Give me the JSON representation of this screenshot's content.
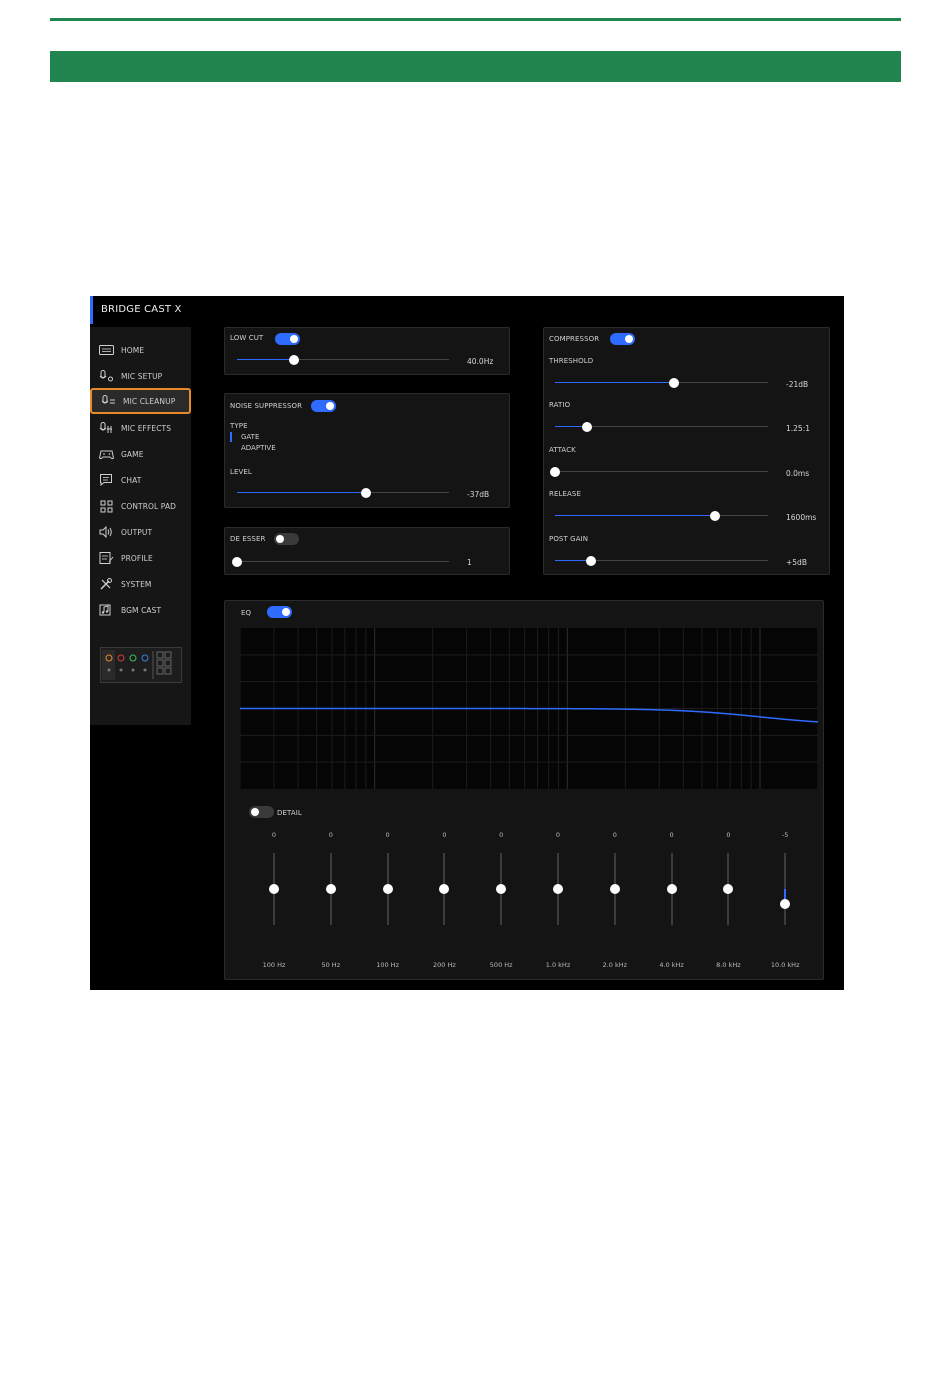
{
  "colors": {
    "doc_green": "#21854f",
    "accent_blue": "#2f6bff",
    "selection_orange": "#e8892a",
    "app_bg": "#000000",
    "panel_bg": "#141414"
  },
  "app": {
    "title": "BRIDGE CAST X"
  },
  "sidebar": {
    "items": [
      {
        "label": "HOME",
        "icon": "home-icon"
      },
      {
        "label": "MIC SETUP",
        "icon": "mic-setup-icon"
      },
      {
        "label": "MIC CLEANUP",
        "icon": "mic-cleanup-icon",
        "selected": true
      },
      {
        "label": "MIC EFFECTS",
        "icon": "mic-effects-icon"
      },
      {
        "label": "GAME",
        "icon": "gamepad-icon"
      },
      {
        "label": "CHAT",
        "icon": "chat-icon"
      },
      {
        "label": "CONTROL PAD",
        "icon": "control-pad-icon"
      },
      {
        "label": "OUTPUT",
        "icon": "speaker-icon"
      },
      {
        "label": "PROFILE",
        "icon": "profile-icon"
      },
      {
        "label": "SYSTEM",
        "icon": "tools-icon"
      },
      {
        "label": "BGM CAST",
        "icon": "music-note-icon"
      }
    ]
  },
  "low_cut": {
    "label": "LOW CUT",
    "enabled": true,
    "value": "40.0Hz",
    "level": 0.27
  },
  "noise_suppressor": {
    "label": "NOISE SUPPRESSOR",
    "enabled": true,
    "type_label": "TYPE",
    "types": [
      "GATE",
      "ADAPTIVE"
    ],
    "selected_type": "GATE",
    "level_label": "LEVEL",
    "level_value": "-37dB",
    "level": 0.61
  },
  "de_esser": {
    "label": "DE ESSER",
    "enabled": false,
    "value": "1",
    "level": 0.0
  },
  "compressor": {
    "label": "COMPRESSOR",
    "enabled": true,
    "params": [
      {
        "label": "THRESHOLD",
        "value": "-21dB",
        "level": 0.56
      },
      {
        "label": "RATIO",
        "value": "1.25:1",
        "level": 0.15
      },
      {
        "label": "ATTACK",
        "value": "0.0ms",
        "level": 0.0
      },
      {
        "label": "RELEASE",
        "value": "1600ms",
        "level": 0.75
      },
      {
        "label": "POST GAIN",
        "value": "+5dB",
        "level": 0.17
      }
    ]
  },
  "eq": {
    "label": "EQ",
    "enabled": true,
    "detail_label": "DETAIL",
    "detail_enabled": false,
    "bands": [
      {
        "gain": "0",
        "freq": "100 Hz",
        "level": 0.5
      },
      {
        "gain": "0",
        "freq": "50 Hz",
        "level": 0.5
      },
      {
        "gain": "0",
        "freq": "100 Hz",
        "level": 0.5
      },
      {
        "gain": "0",
        "freq": "200 Hz",
        "level": 0.5
      },
      {
        "gain": "0",
        "freq": "500 Hz",
        "level": 0.5
      },
      {
        "gain": "0",
        "freq": "1.0 kHz",
        "level": 0.5
      },
      {
        "gain": "0",
        "freq": "2.0 kHz",
        "level": 0.5
      },
      {
        "gain": "0",
        "freq": "4.0 kHz",
        "level": 0.5
      },
      {
        "gain": "0",
        "freq": "8.0 kHz",
        "level": 0.5
      },
      {
        "gain": "-5",
        "freq": "10.0 kHz",
        "level": 0.29
      }
    ]
  }
}
